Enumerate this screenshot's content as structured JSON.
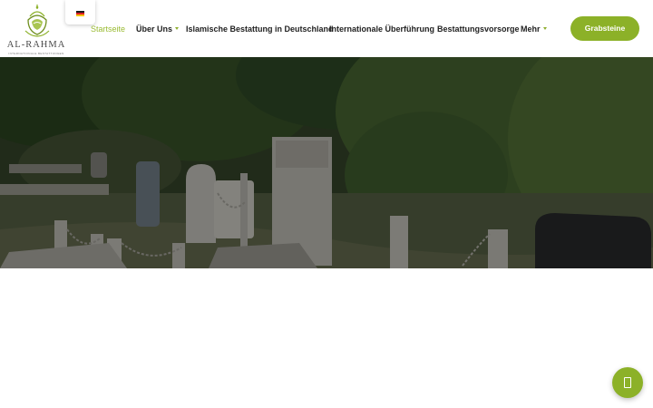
{
  "brand": {
    "logo_text": "AL-RAHMA",
    "logo_subtitle": "INTERNATIONALE BESTATTUNGEN",
    "colors": {
      "accent": "#8cb128",
      "active_nav": "#9abb33",
      "text": "#222222"
    }
  },
  "language": {
    "current": "de",
    "flag_icon": "germany-flag-icon"
  },
  "nav": {
    "items": [
      {
        "label": "Startseite",
        "active": true,
        "has_dropdown": false
      },
      {
        "label": "Über Uns",
        "active": false,
        "has_dropdown": true
      },
      {
        "label": "Islamische Bestattung in Deutschland",
        "active": false,
        "has_dropdown": false
      },
      {
        "label": "Internationale Überführung",
        "active": false,
        "has_dropdown": false
      },
      {
        "label": "Bestattungsvorsorge",
        "active": false,
        "has_dropdown": false
      },
      {
        "label": "Mehr",
        "active": false,
        "has_dropdown": true
      }
    ]
  },
  "cta": {
    "label": "Grabsteine"
  },
  "hero": {
    "image": "cemetery-gravestones-photo"
  },
  "floating_button": {
    "icon": "mobile-phone-icon"
  }
}
